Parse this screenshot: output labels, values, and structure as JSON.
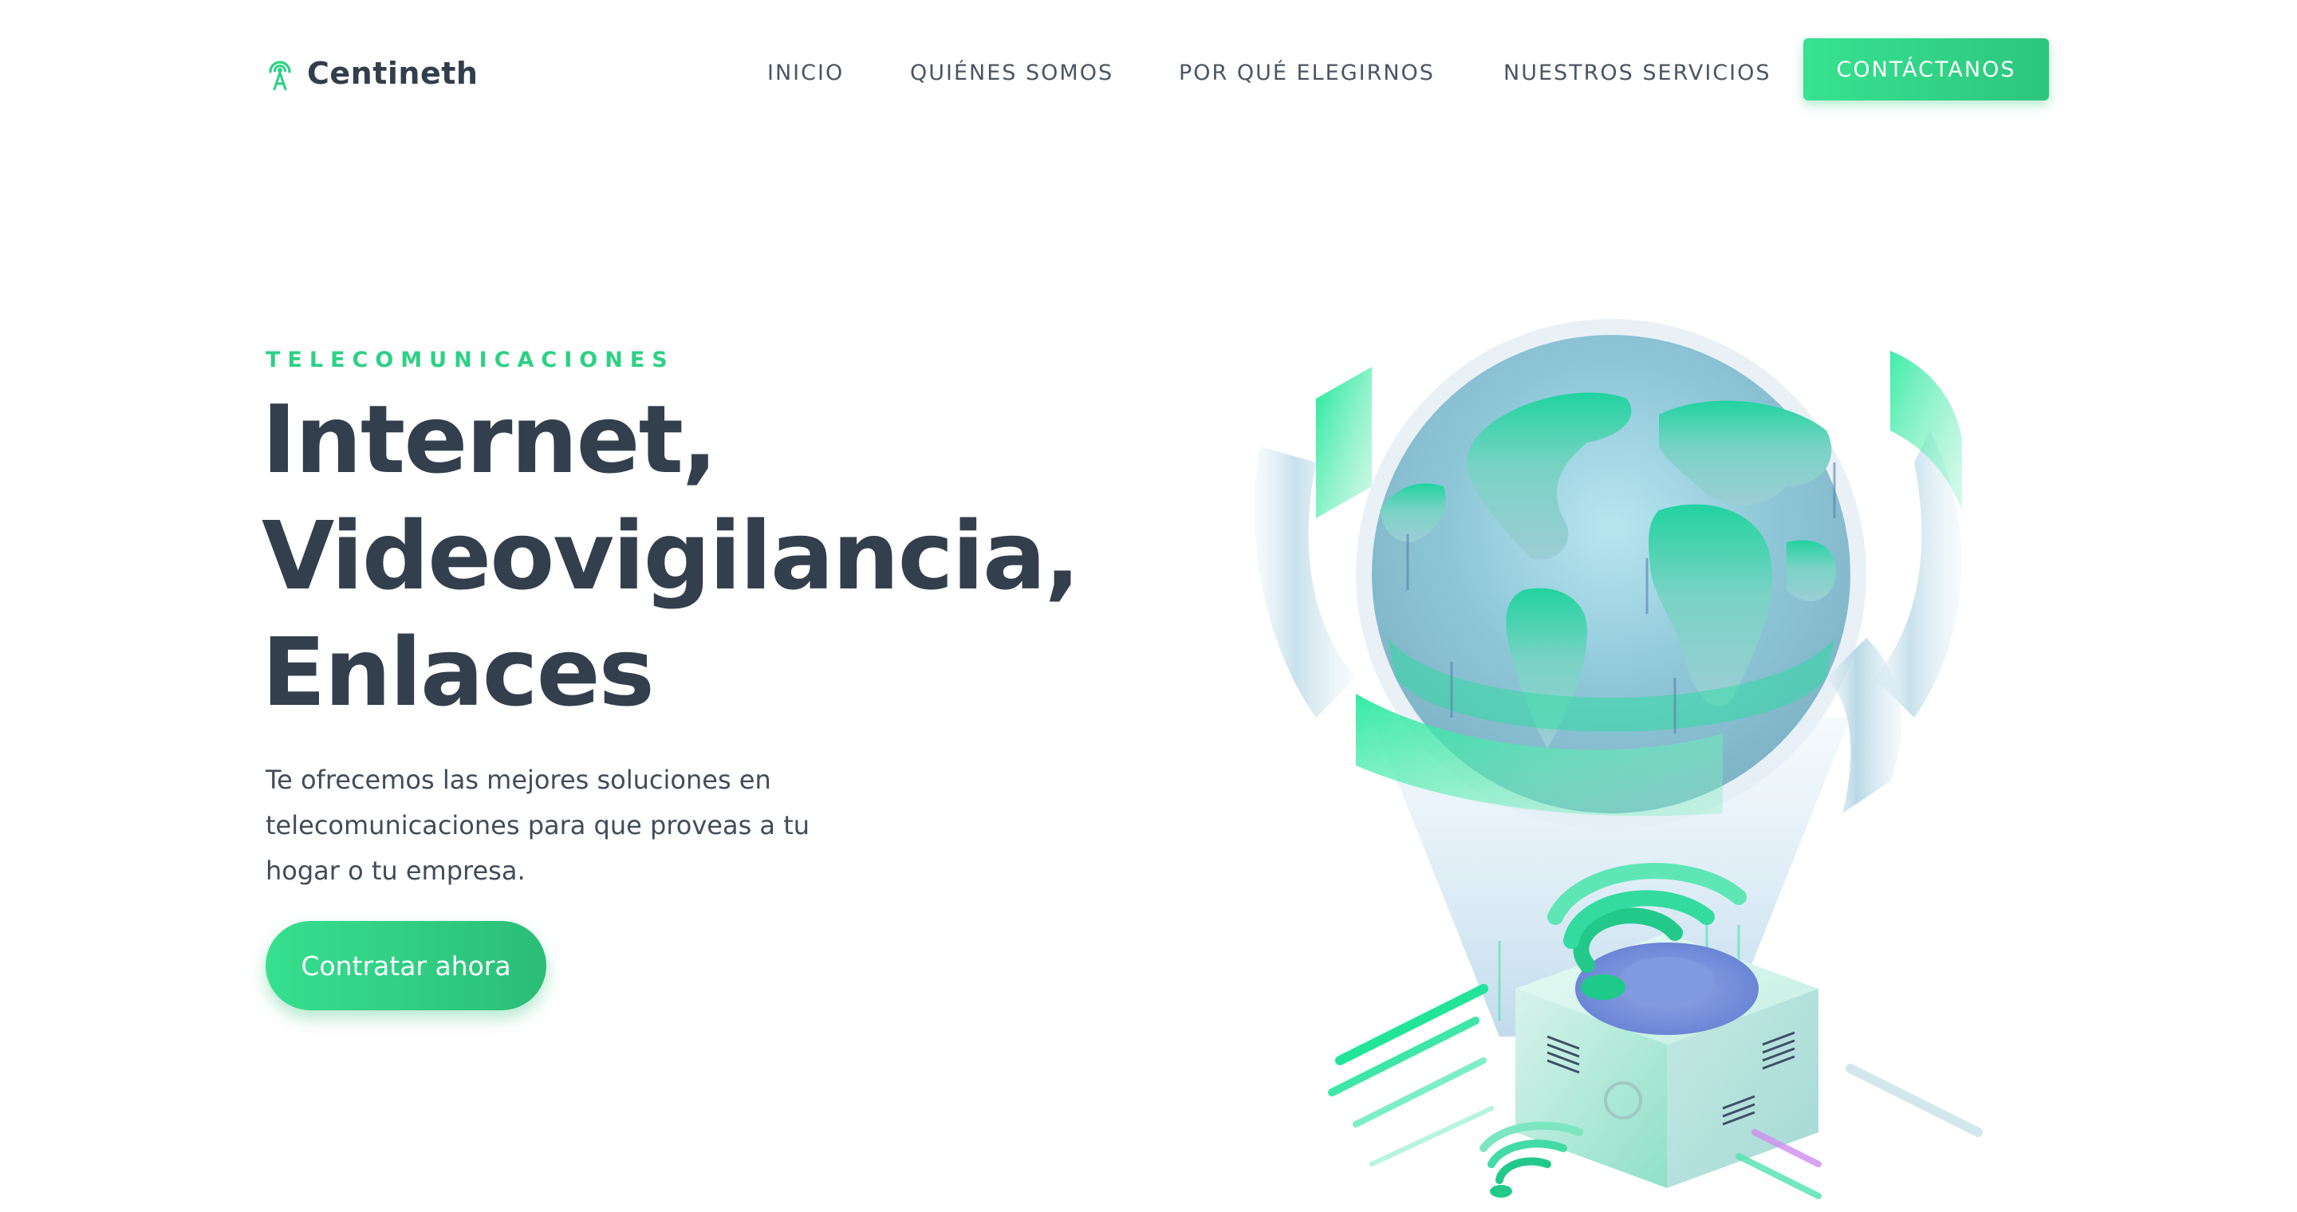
{
  "header": {
    "brand": {
      "name": "Centineth",
      "icon": "antenna-signal-icon",
      "color": "#2dd185"
    },
    "nav": [
      {
        "label": "INICIO"
      },
      {
        "label": "QUIÉNES SOMOS"
      },
      {
        "label": "POR QUÉ ELEGIRNOS"
      },
      {
        "label": "NUESTROS SERVICIOS"
      }
    ],
    "cta_label": "CONTÁCTANOS"
  },
  "hero": {
    "eyebrow": "TELECOMUNICACIONES",
    "headline_lines": [
      "Internet,",
      "Videovigilancia,",
      "Enlaces"
    ],
    "lead": "Te ofrecemos las mejores soluciones en telecomunicaciones para que proveas a tu hogar o tu empresa.",
    "cta_label": "Contratar ahora",
    "illustration": "globe-router-wifi-illustration"
  },
  "colors": {
    "accent": "#2dd185",
    "accent_dark": "#2bbd78",
    "heading": "#333f4d",
    "text": "#414c58"
  }
}
